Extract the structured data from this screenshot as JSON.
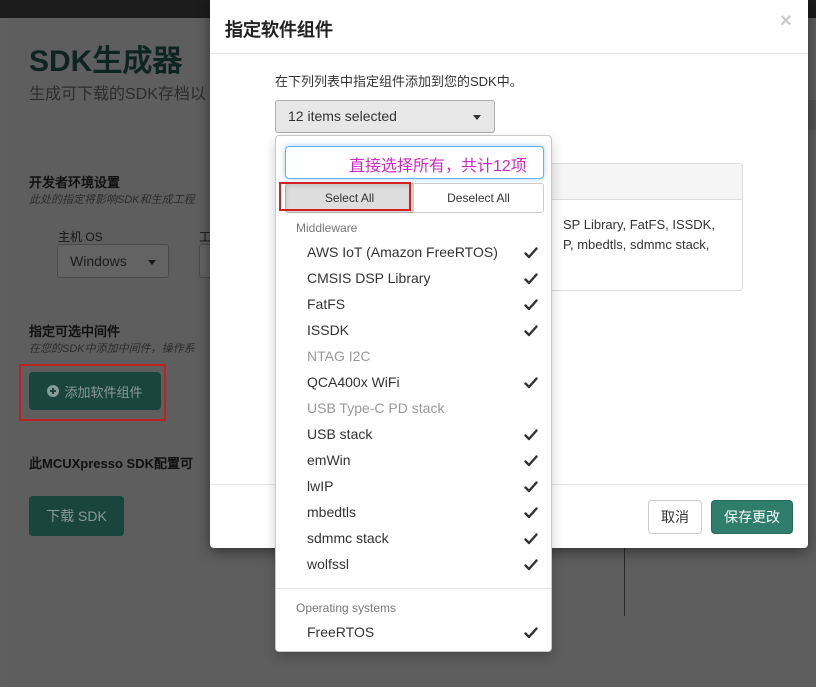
{
  "background": {
    "title": "SDK生成器",
    "subtitle": "生成可下载的SDK存档以",
    "env_heading": "开发者环境设置",
    "env_sub": "此处的指定将影响SDK和生成工程",
    "host_os_label": "主机 OS",
    "toolchain_label": "工",
    "host_os_value": "Windows",
    "middleware_heading": "指定可选中间件",
    "middleware_sub": "在您的SDK中添加中间件，操作系",
    "add_button": "添加软件组件",
    "config_heading": "此MCUXpresso SDK配置可",
    "download_button": "下载 SDK"
  },
  "modal": {
    "title": "指定软件组件",
    "close": "×",
    "instruction": "在下列列表中指定组件添加到您的SDK中。",
    "multiselect_label": "12 items selected",
    "panel_lines": [
      "SP Library,  FatFS,  ISSDK,",
      "P,  mbedtls,  sdmmc stack,"
    ],
    "cancel": "取消",
    "save": "保存更改"
  },
  "dropdown": {
    "search_value": "",
    "annotation": "直接选择所有，共计12项",
    "select_all": "Select All",
    "deselect_all": "Deselect All",
    "groups": [
      {
        "label": "Middleware",
        "options": [
          {
            "label": "AWS IoT (Amazon FreeRTOS)",
            "checked": true,
            "disabled": false
          },
          {
            "label": "CMSIS DSP Library",
            "checked": true,
            "disabled": false
          },
          {
            "label": "FatFS",
            "checked": true,
            "disabled": false
          },
          {
            "label": "ISSDK",
            "checked": true,
            "disabled": false
          },
          {
            "label": "NTAG I2C",
            "checked": false,
            "disabled": true
          },
          {
            "label": "QCA400x WiFi",
            "checked": true,
            "disabled": false
          },
          {
            "label": "USB Type-C PD stack",
            "checked": false,
            "disabled": true
          },
          {
            "label": "USB stack",
            "checked": true,
            "disabled": false
          },
          {
            "label": "emWin",
            "checked": true,
            "disabled": false
          },
          {
            "label": "lwIP",
            "checked": true,
            "disabled": false
          },
          {
            "label": "mbedtls",
            "checked": true,
            "disabled": false
          },
          {
            "label": "sdmmc stack",
            "checked": true,
            "disabled": false
          },
          {
            "label": "wolfssl",
            "checked": true,
            "disabled": false
          }
        ]
      },
      {
        "label": "Operating systems",
        "options": [
          {
            "label": "FreeRTOS",
            "checked": true,
            "disabled": false
          }
        ]
      }
    ]
  },
  "colors": {
    "accent": "#2e7e6b",
    "annotation": "#d426c4",
    "highlight_box": "#d42020"
  },
  "icons": {
    "add_button_icon": "plus-circle-icon",
    "select_caret": "caret-down-icon",
    "option_check": "check-icon",
    "close": "close-icon"
  }
}
